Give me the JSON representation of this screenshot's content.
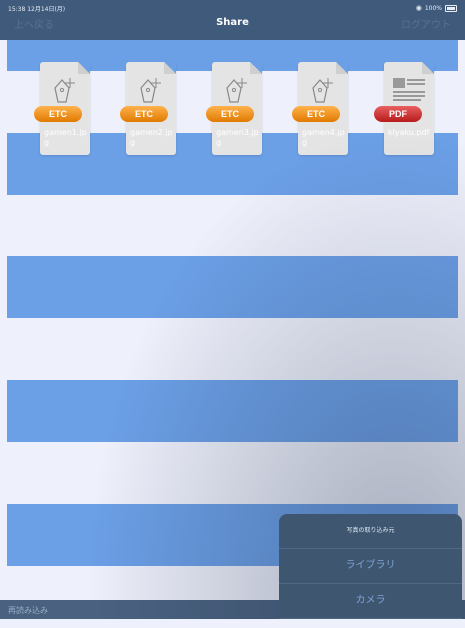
{
  "status_bar": {
    "time": "15:38  12月14日(月)",
    "wifi_icon": "wifi-icon",
    "battery": "100%"
  },
  "nav": {
    "back_label": "上へ戻る",
    "title": "Share",
    "logout_label": "ログアウト"
  },
  "files": [
    {
      "name": "gamen1.jpg",
      "badge": "ETC",
      "icon": "pen-tool-icon"
    },
    {
      "name": "gamen2.jpg",
      "badge": "ETC",
      "icon": "pen-tool-icon"
    },
    {
      "name": "gamen3.jpg",
      "badge": "ETC",
      "icon": "pen-tool-icon"
    },
    {
      "name": "gamen4.jpg",
      "badge": "ETC",
      "icon": "pen-tool-icon"
    },
    {
      "name": "kiyaku.pdf",
      "badge": "PDF",
      "icon": "document-thumbnail-icon"
    }
  ],
  "action_sheet": {
    "title": "写真の取り込み元",
    "options": [
      "ライブラリ",
      "カメラ"
    ]
  },
  "bottom_bar": {
    "reload_label": "再読み込み"
  },
  "colors": {
    "nav_bg": "#3f5a7a",
    "stripe_blue": "#6b9fe6",
    "stripe_light": "#eef0fb",
    "etc_badge": "#f08c1c",
    "pdf_badge": "#c72a2a"
  }
}
